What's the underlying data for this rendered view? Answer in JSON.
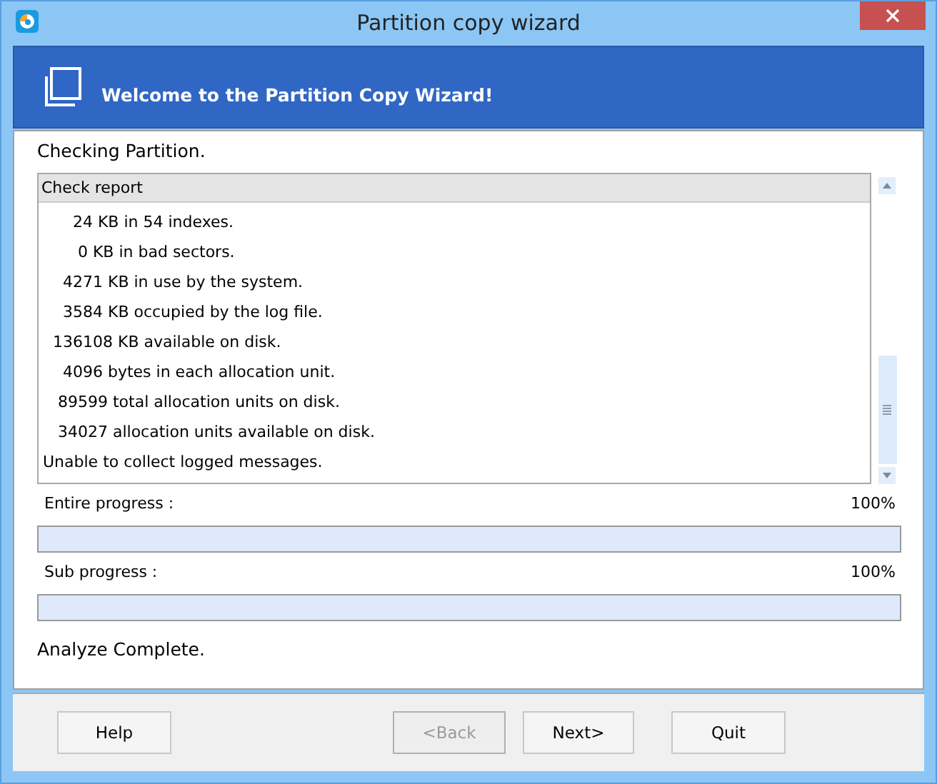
{
  "window": {
    "title": "Partition copy wizard"
  },
  "header": {
    "title": "Welcome to the Partition Copy Wizard!"
  },
  "status": "Checking Partition.",
  "report": {
    "title": "Check report",
    "lines": [
      "      24 KB in 54 indexes.",
      "       0 KB in bad sectors.",
      "    4271 KB in use by the system.",
      "    3584 KB occupied by the log file.",
      "  136108 KB available on disk.",
      "    4096 bytes in each allocation unit.",
      "   89599 total allocation units on disk.",
      "   34027 allocation units available on disk.",
      "Unable to collect logged messages."
    ]
  },
  "progress": [
    {
      "label": "Entire progress :",
      "reading": "100%",
      "level": 1
    },
    {
      "label": "Sub progress :",
      "reading": "100%",
      "level": 1
    }
  ],
  "result": "Analyze Complete.",
  "buttons": [
    {
      "label": "Help",
      "disabled": false
    },
    {
      "label": "<Back",
      "disabled": true
    },
    {
      "label": "Next>",
      "disabled": false
    },
    {
      "label": "Quit",
      "disabled": false
    }
  ]
}
